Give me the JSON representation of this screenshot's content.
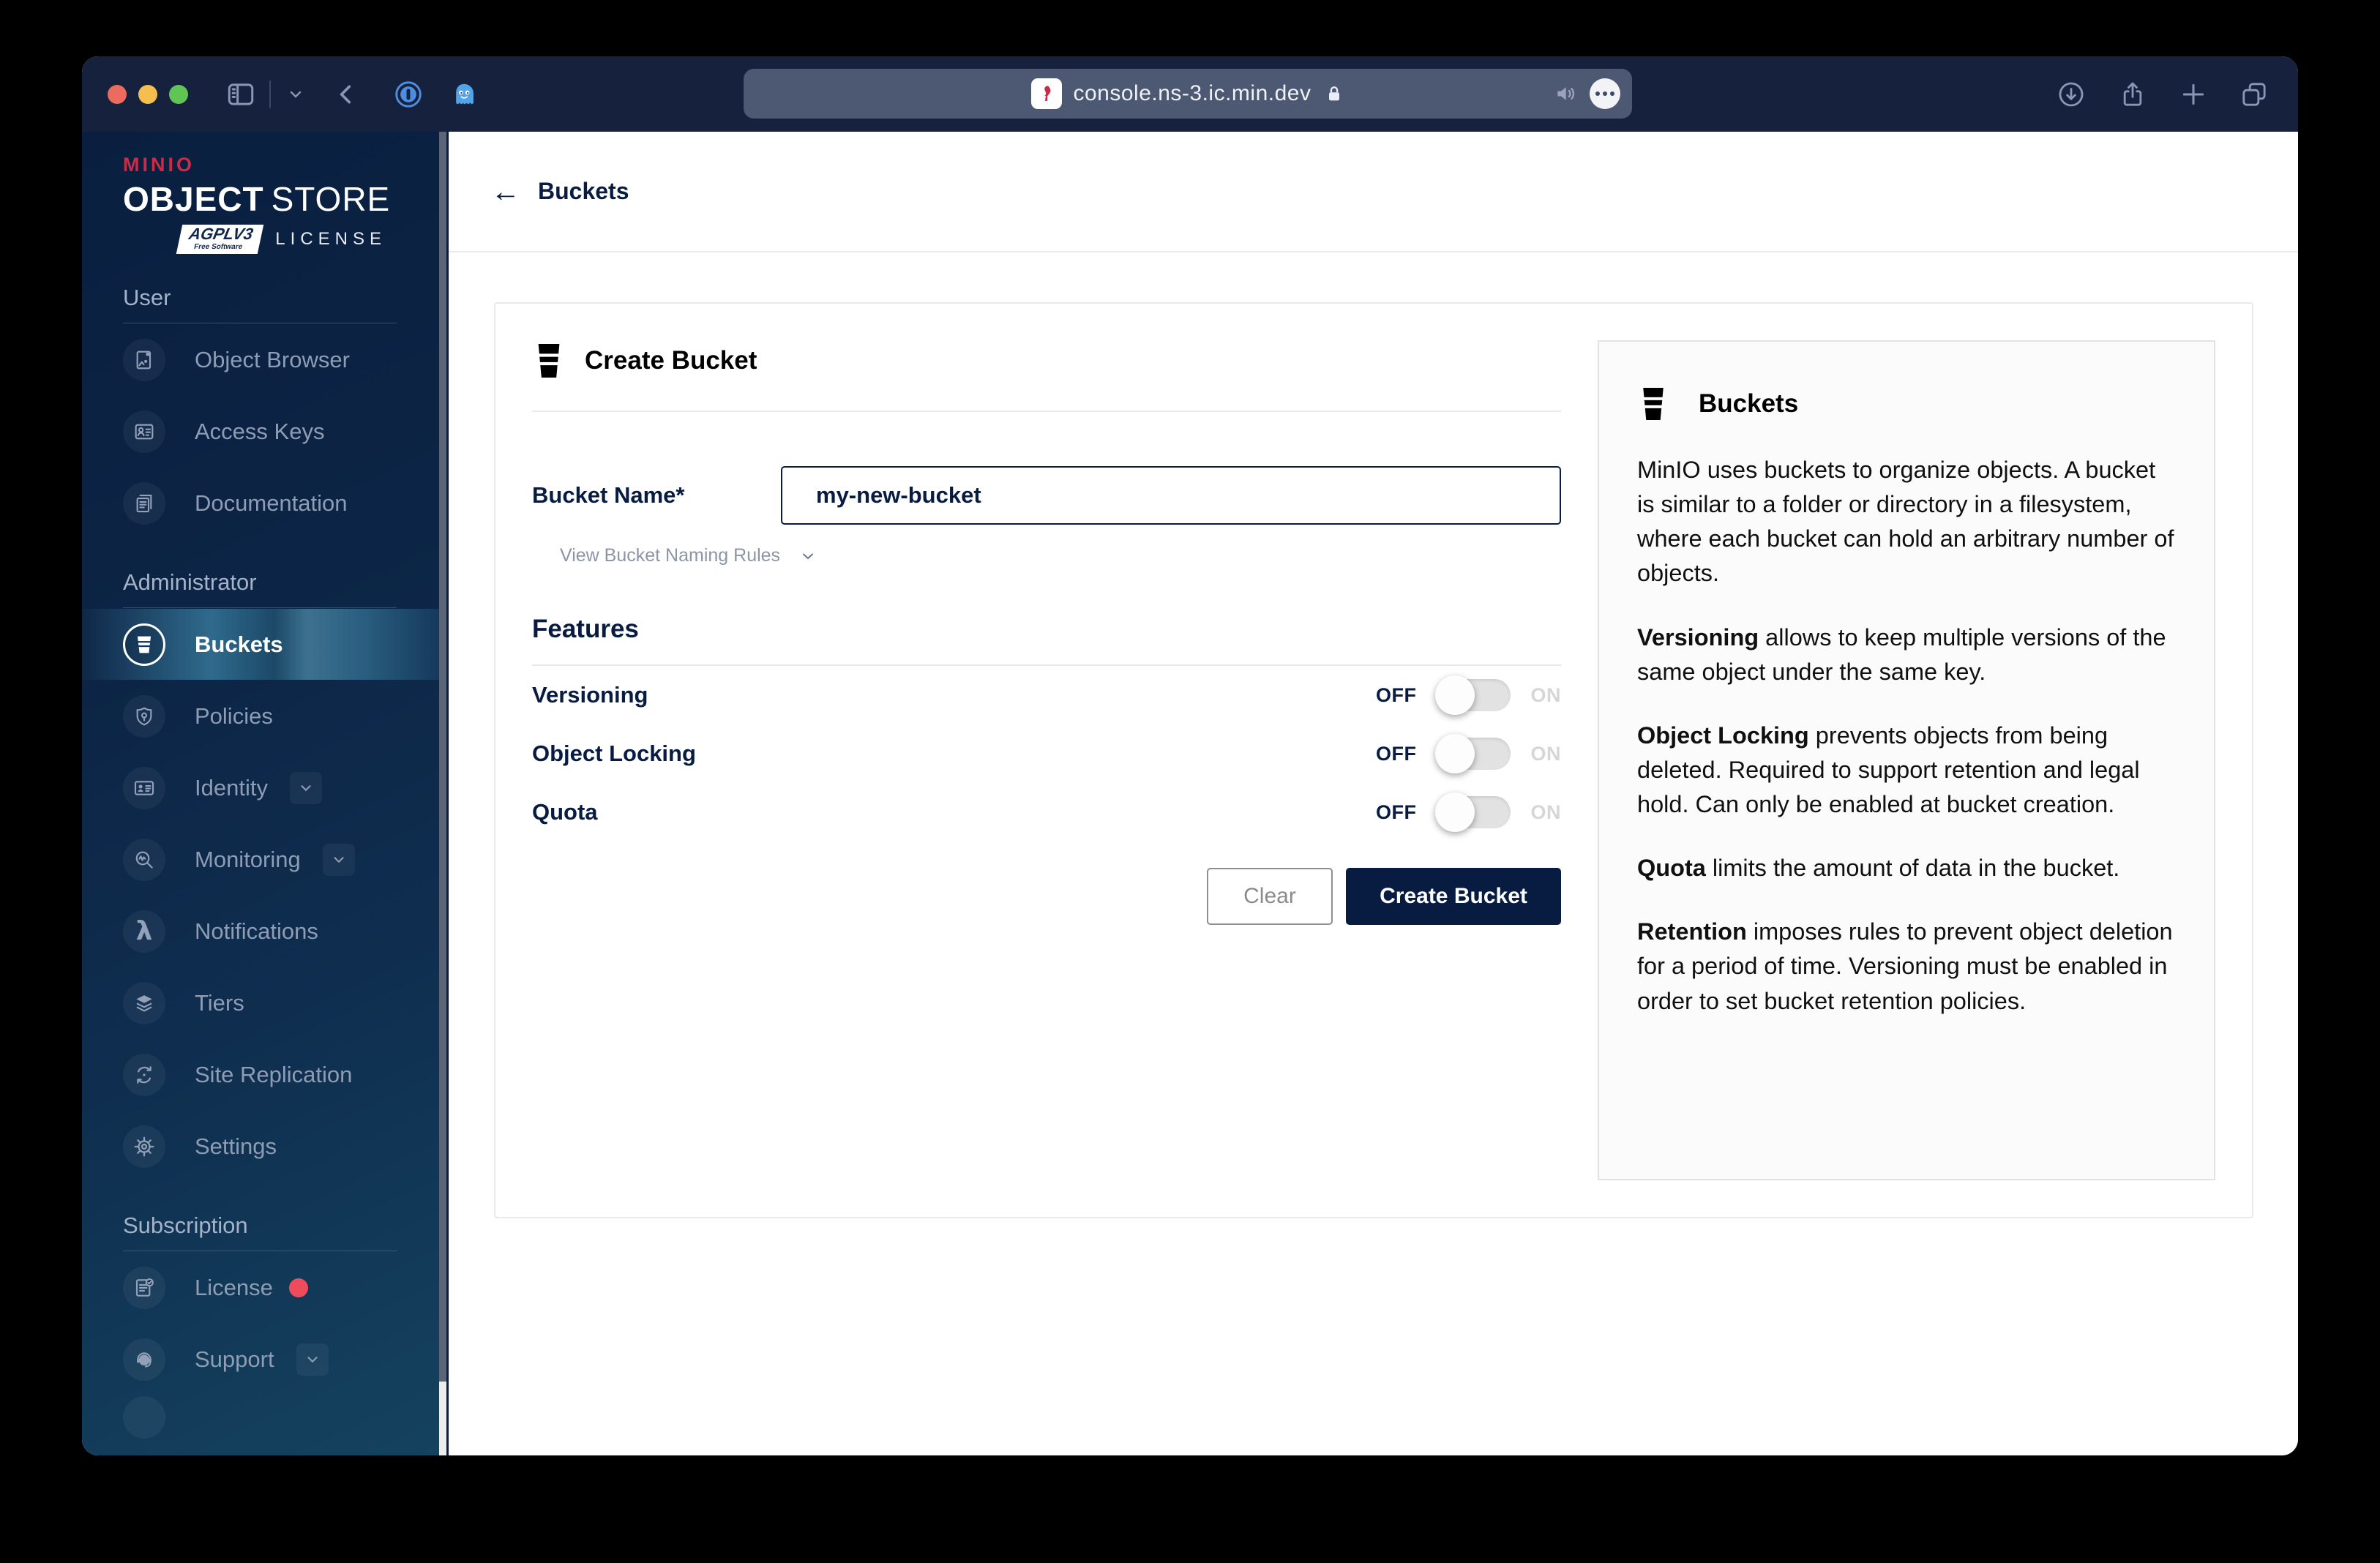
{
  "browser": {
    "url": "console.ns-3.ic.min.dev"
  },
  "sidebar": {
    "brand": "MINIO",
    "product_bold": "OBJECT",
    "product_light": "STORE",
    "license_badge": "AGPLV3",
    "license_badge_sub": "Free Software",
    "license_label": "LICENSE",
    "sections": [
      {
        "label": "User",
        "items": [
          {
            "label": "Object Browser"
          },
          {
            "label": "Access Keys"
          },
          {
            "label": "Documentation"
          }
        ]
      },
      {
        "label": "Administrator",
        "items": [
          {
            "label": "Buckets",
            "selected": true
          },
          {
            "label": "Policies"
          },
          {
            "label": "Identity",
            "chevron": true
          },
          {
            "label": "Monitoring",
            "chevron": true
          },
          {
            "label": "Notifications"
          },
          {
            "label": "Tiers"
          },
          {
            "label": "Site Replication"
          },
          {
            "label": "Settings"
          }
        ]
      },
      {
        "label": "Subscription",
        "items": [
          {
            "label": "License",
            "badge": true
          },
          {
            "label": "Support",
            "chevron": true
          }
        ]
      }
    ]
  },
  "page": {
    "back_label": "Buckets",
    "card": {
      "title": "Create Bucket",
      "bucket_name_label": "Bucket Name*",
      "bucket_name_value": "my-new-bucket",
      "naming_rules_label": "View Bucket Naming Rules",
      "features_title": "Features",
      "toggle_off": "OFF",
      "toggle_on": "ON",
      "features": [
        {
          "label": "Versioning",
          "state": "off"
        },
        {
          "label": "Object Locking",
          "state": "off"
        },
        {
          "label": "Quota",
          "state": "off"
        }
      ],
      "clear_label": "Clear",
      "submit_label": "Create Bucket"
    },
    "help": {
      "title": "Buckets",
      "paragraphs": [
        {
          "bold": "",
          "text": "MinIO uses buckets to organize objects. A bucket is similar to a folder or directory in a filesystem, where each bucket can hold an arbitrary number of objects."
        },
        {
          "bold": "Versioning",
          "text": " allows to keep multiple versions of the same object under the same key."
        },
        {
          "bold": "Object Locking",
          "text": " prevents objects from being deleted. Required to support retention and legal hold. Can only be enabled at bucket creation."
        },
        {
          "bold": "Quota",
          "text": " limits the amount of data in the bucket."
        },
        {
          "bold": "Retention",
          "text": " imposes rules to prevent object deletion for a period of time. Versioning must be enabled in order to set bucket retention policies."
        }
      ]
    }
  },
  "colors": {
    "navy": "#081C42",
    "brand_red": "#C72C48",
    "badge_red": "#EE4C5C"
  }
}
